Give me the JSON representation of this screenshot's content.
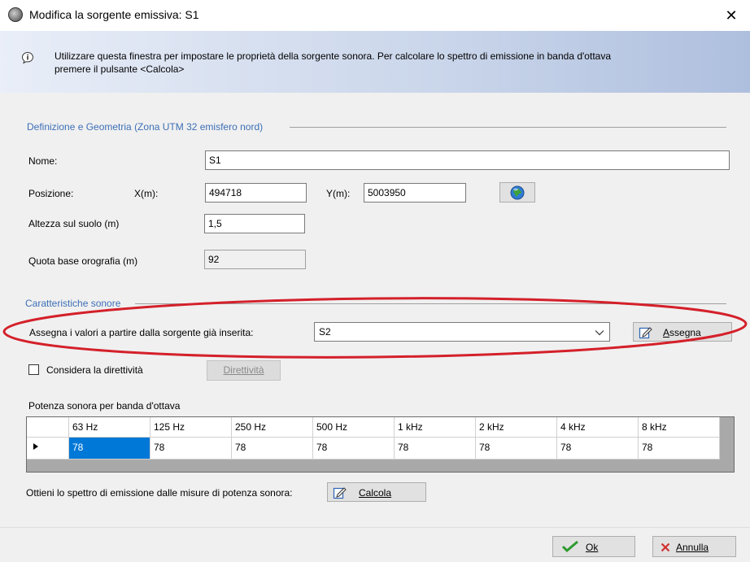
{
  "window": {
    "title": "Modifica la sorgente emissiva: S1",
    "close_glyph": "✕"
  },
  "info": {
    "text_line1": "Utilizzare questa finestra per impostare le proprietà della sorgente sonora. Per calcolare lo spettro di emissione in banda d'ottava",
    "text_line2": "premere il pulsante <Calcola>"
  },
  "geometry": {
    "section_title": "Definizione e Geometria (Zona UTM 32 emisfero nord)",
    "name_label": "Nome:",
    "name_value": "S1",
    "position_label": "Posizione:",
    "x_label": "X(m):",
    "x_value": "494718",
    "y_label": "Y(m):",
    "y_value": "5003950",
    "globe_icon": "globe-icon",
    "height_label": "Altezza sul suolo (m)",
    "height_value": "1,5",
    "base_label": "Quota base orografia (m)",
    "base_value": "92"
  },
  "sound": {
    "section_title": "Caratteristiche sonore",
    "assign_label": "Assegna i valori a partire dalla sorgente già inserita:",
    "assign_selected": "S2",
    "assign_button_label": "Assegna",
    "assign_button_mnemonic": "A",
    "directivity_checkbox_label": "Considera la direttività",
    "directivity_checked": false,
    "directivity_button_label": "Direttività",
    "power_label": "Potenza sonora per banda d'ottava",
    "bands": [
      "63 Hz",
      "125 Hz",
      "250 Hz",
      "500 Hz",
      "1 kHz",
      "2 kHz",
      "4 kHz",
      "8 kHz"
    ],
    "values": [
      "78",
      "78",
      "78",
      "78",
      "78",
      "78",
      "78",
      "78"
    ],
    "spectrum_label": "Ottieni lo spettro di emissione dalle misure di potenza sonora:",
    "calc_button_label": "Calcola"
  },
  "footer": {
    "ok_label": "Ok",
    "cancel_label": "Annulla"
  },
  "colors": {
    "section_title": "#3d6fb6",
    "highlight_ellipse": "#d4202a",
    "selected_cell": "#0078d7"
  }
}
